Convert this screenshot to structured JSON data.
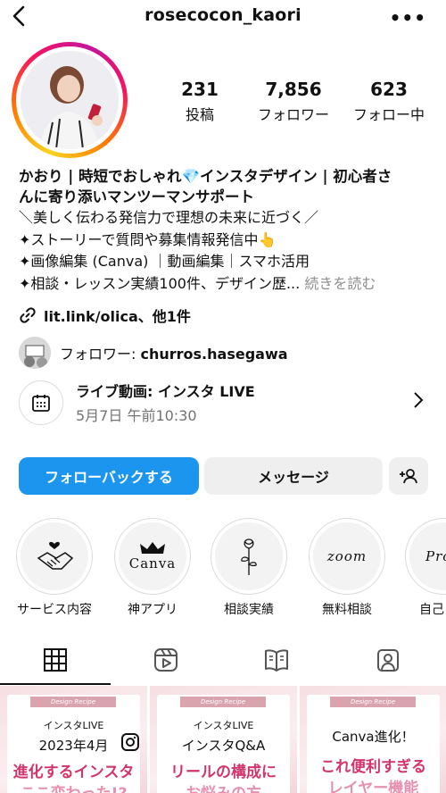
{
  "header": {
    "username": "rosecocon_kaori"
  },
  "stats": [
    {
      "value": "231",
      "label": "投稿"
    },
    {
      "value": "7,856",
      "label": "フォロワー"
    },
    {
      "value": "623",
      "label": "フォロー中"
    }
  ],
  "bio": {
    "name_line1": "かおり | 時短でおしゃれ💎インスタデザイン | 初心者さ",
    "name_line2": "んに寄り添いマンツーマンサポート",
    "lines": [
      "＼美しく伝わる発信力で理想の未来に近づく／",
      "✦ストーリーで質問や募集情報発信中👆",
      "✦画像編集 (Canva) ｜動画編集｜スマホ活用",
      "✦相談・レッスン実績100件、デザイン歴..."
    ],
    "more": "続きを読む",
    "link": "lit.link/olica、他1件"
  },
  "followed_by": {
    "prefix": "フォロワー: ",
    "user": "churros.hasegawa"
  },
  "event": {
    "title": "ライブ動画: インスタ LIVE",
    "date": "5月7日 午前10:30"
  },
  "buttons": {
    "follow_back": "フォローバックする",
    "message": "メッセージ"
  },
  "highlights": [
    {
      "label": "サービス内容",
      "icon": "handshake-icon"
    },
    {
      "label": "神アプリ",
      "text": "Canva",
      "icon": "crown-icon"
    },
    {
      "label": "相談実績",
      "icon": "rose-icon"
    },
    {
      "label": "無料相談",
      "text": "zoom"
    },
    {
      "label": "自己",
      "text": "Pro"
    }
  ],
  "tiles": [
    {
      "ribbon": "Design Recipe",
      "sub": "インスタLIVE",
      "mid": "2023年4月",
      "big": "進化するインスタ",
      "big2": "ここ変わった!?"
    },
    {
      "ribbon": "Design Recipe",
      "sub": "インスタLIVE",
      "mid": "インスタQ&A",
      "big": "リールの構成に",
      "big2": "お悩みの方"
    },
    {
      "ribbon": "Design Recipe",
      "sub": "",
      "mid": "Canva進化！",
      "big": "これ便利すぎる",
      "big2": "レイヤー機能"
    }
  ],
  "colors": {
    "accent": "#1b95ee",
    "brand_pink": "#d2356c"
  }
}
